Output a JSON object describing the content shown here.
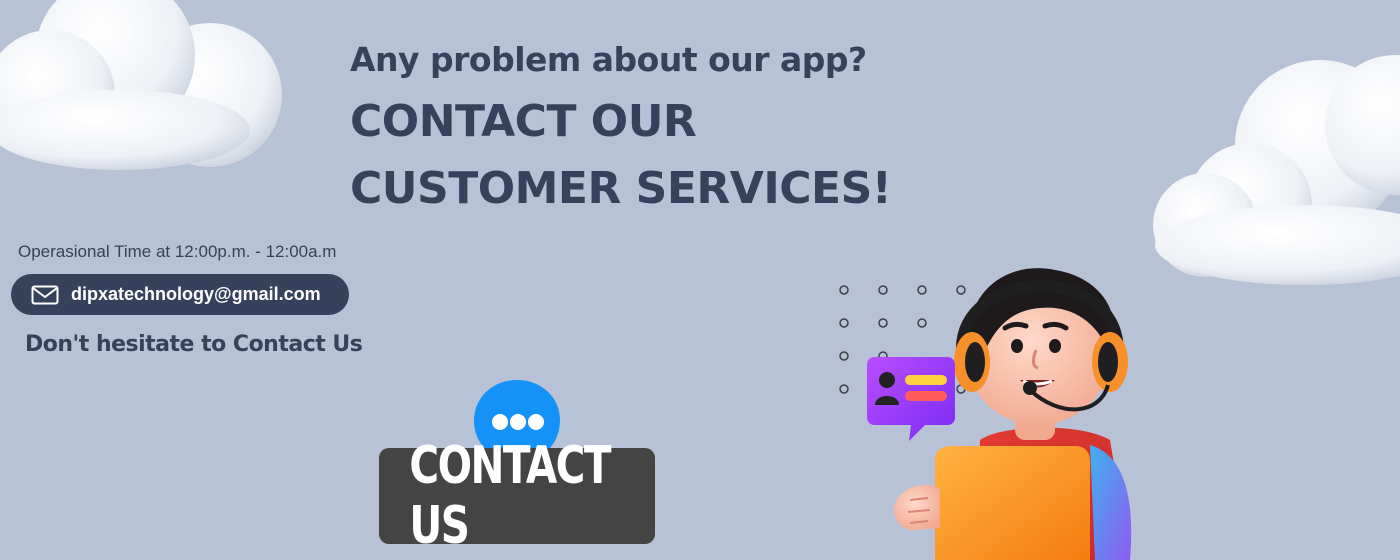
{
  "headline": {
    "question": "Any problem about our app?",
    "line1": "CONTACT OUR",
    "line2": "CUSTOMER SERVICES!"
  },
  "contact": {
    "operational_time": "Operasional Time at 12:00p.m. - 12:00a.m",
    "email": "dipxatechnology@gmail.com",
    "tagline": "Don't hesitate to Contact Us",
    "button_label": "CONTACT US"
  },
  "icons": {
    "email": "mail-envelope-icon",
    "chat_bubble": "chat-bubble-icon",
    "profile_card": "profile-card-bubble-icon",
    "agent": "customer-service-agent-illustration"
  },
  "colors": {
    "background": "#b8c2d6",
    "text_dark": "#34425c",
    "pill": "#36425c",
    "button": "#444444",
    "chat_blue": "#1592f7"
  }
}
